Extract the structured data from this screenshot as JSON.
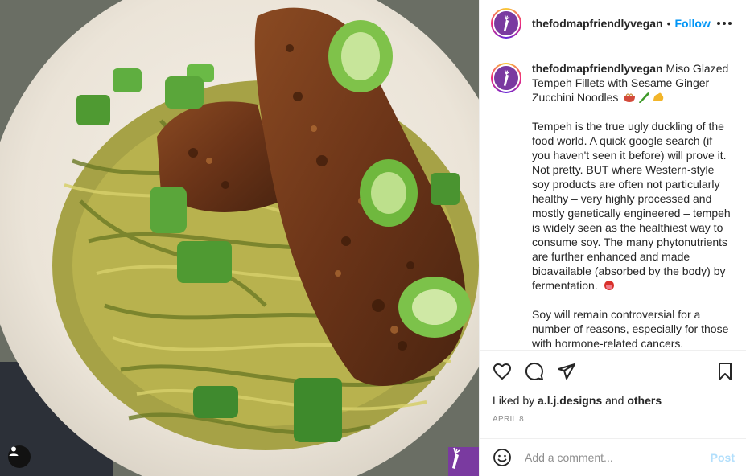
{
  "post": {
    "username": "thefodmapfriendlyvegan",
    "separator": "•",
    "follow_label": "Follow",
    "more_options_icon": "more-horizontal-icon"
  },
  "caption": {
    "username": "thefodmapfriendlyvegan",
    "title": "Miso Glazed Tempeh Fillets with Sesame Ginger Zucchini Noodles",
    "title_emojis": [
      "bowl-noodles-emoji",
      "cucumber-emoji",
      "flexed-biceps-emoji"
    ],
    "paragraph1": "Tempeh is the true ugly duckling of the food world. A quick google search (if you haven't seen it before) will prove it. Not pretty. BUT where Western-style soy products are often not particularly healthy – very highly processed and mostly genetically engineered – tempeh is widely seen as the healthiest way to consume soy. The many phytonutrients are further enhanced and made bioavailable (absorbed by the body) by fermentation.",
    "paragraph1_emoji": "tongue-emoji",
    "paragraph2": "Soy will remain controversial for a number of reasons, especially for those with hormone-related cancers. However,"
  },
  "actions": {
    "like_icon": "heart-icon",
    "comment_icon": "comment-icon",
    "share_icon": "paper-plane-icon",
    "save_icon": "bookmark-icon",
    "liked_by_prefix": "Liked by",
    "liked_by_user": "a.l.j.designs",
    "liked_by_and": "and",
    "liked_by_others": "others",
    "date": "April 8"
  },
  "comment_box": {
    "placeholder": "Add a comment...",
    "post_label": "Post",
    "emoji_icon": "smiley-icon"
  },
  "colors": {
    "accent_blue": "#0095f6",
    "post_disabled": "#b2dffc",
    "brand_purple": "#7a3aa0"
  }
}
